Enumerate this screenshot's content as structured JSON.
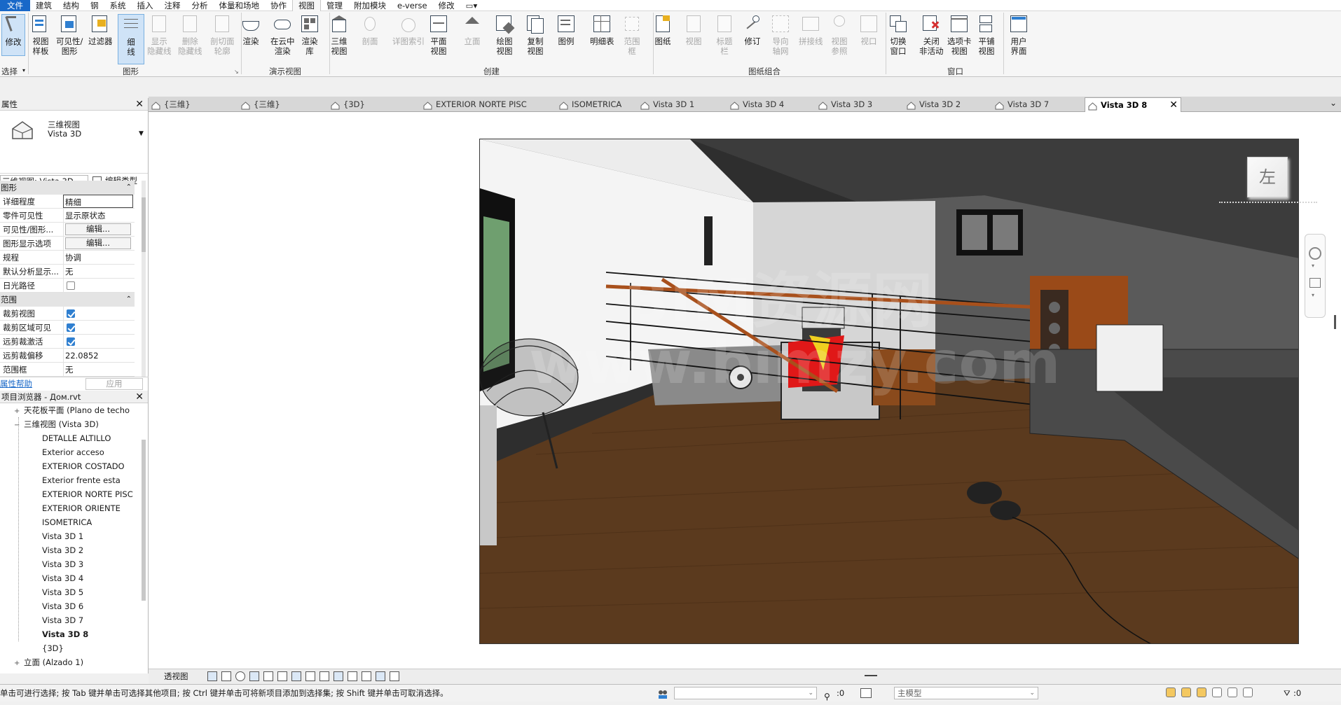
{
  "menu": {
    "items": [
      "文件",
      "建筑",
      "结构",
      "钢",
      "系统",
      "插入",
      "注释",
      "分析",
      "体量和场地",
      "协作",
      "视图",
      "管理",
      "附加模块",
      "e-verse",
      "修改"
    ],
    "active": "视图"
  },
  "ribbon": {
    "buttons": [
      {
        "label": "修改",
        "group": "select"
      },
      {
        "label": "视图\n样板",
        "group": "graphics"
      },
      {
        "label": "可见性/\n图形",
        "group": "graphics"
      },
      {
        "label": "过滤器",
        "group": "graphics"
      },
      {
        "label": "细\n线",
        "group": "graphics"
      },
      {
        "label": "显示\n隐藏线",
        "group": "graphics",
        "disabled": true
      },
      {
        "label": "删除\n隐藏线",
        "group": "graphics",
        "disabled": true
      },
      {
        "label": "剖切面\n轮廓",
        "group": "graphics",
        "disabled": true
      },
      {
        "label": "渲染",
        "group": "presentation"
      },
      {
        "label": "在云中\n渲染",
        "group": "presentation"
      },
      {
        "label": "渲染\n库",
        "group": "presentation"
      },
      {
        "label": "三维\n视图",
        "group": "create"
      },
      {
        "label": "剖面",
        "group": "create",
        "disabled": true
      },
      {
        "label": "详图索引",
        "group": "create",
        "disabled": true
      },
      {
        "label": "平面\n视图",
        "group": "create"
      },
      {
        "label": "立面",
        "group": "create",
        "disabled": true
      },
      {
        "label": "绘图\n视图",
        "group": "create"
      },
      {
        "label": "复制\n视图",
        "group": "create"
      },
      {
        "label": "图例",
        "group": "create"
      },
      {
        "label": "明细表",
        "group": "create"
      },
      {
        "label": "范围\n框",
        "group": "create",
        "disabled": true
      },
      {
        "label": "图纸",
        "group": "sheet"
      },
      {
        "label": "视图",
        "group": "sheet",
        "disabled": true
      },
      {
        "label": "标题\n栏",
        "group": "sheet",
        "disabled": true
      },
      {
        "label": "修订",
        "group": "sheet"
      },
      {
        "label": "导向\n轴网",
        "group": "sheet",
        "disabled": true
      },
      {
        "label": "拼接线",
        "group": "sheet",
        "disabled": true
      },
      {
        "label": "视图\n参照",
        "group": "sheet",
        "disabled": true
      },
      {
        "label": "视口",
        "group": "sheet",
        "disabled": true
      },
      {
        "label": "切换\n窗口",
        "group": "window"
      },
      {
        "label": "关闭\n非活动",
        "group": "window"
      },
      {
        "label": "选项卡\n视图",
        "group": "window"
      },
      {
        "label": "平铺\n视图",
        "group": "window"
      },
      {
        "label": "用户\n界面",
        "group": "window"
      }
    ],
    "panels": {
      "select": "选择",
      "graphics": "图形",
      "presentation": "演示视图",
      "create": "创建",
      "sheet": "图纸组合",
      "window": "窗口"
    }
  },
  "properties": {
    "title": "属性",
    "type_line1": "三维视图",
    "type_line2": "Vista 3D",
    "view_selector": "三维视图: Vista 3D",
    "edit_type": "编辑类型",
    "section_graphics": "图形",
    "rows_graphics": [
      {
        "k": "详细程度",
        "v": "精细"
      },
      {
        "k": "零件可见性",
        "v": "显示原状态"
      },
      {
        "k": "可见性/图形...",
        "v": "编辑..."
      },
      {
        "k": "图形显示选项",
        "v": "编辑..."
      },
      {
        "k": "规程",
        "v": "协调"
      },
      {
        "k": "默认分析显示...",
        "v": "无"
      },
      {
        "k": "日光路径",
        "v": ""
      }
    ],
    "section_extents": "范围",
    "rows_extents": [
      {
        "k": "裁剪视图",
        "checked": true
      },
      {
        "k": "裁剪区域可见",
        "checked": true
      },
      {
        "k": "远剪裁激活",
        "checked": true
      },
      {
        "k": "远剪裁偏移",
        "v": "22.0852"
      },
      {
        "k": "范围框",
        "v": "无"
      }
    ],
    "help_link": "属性帮助",
    "apply": "应用"
  },
  "browser": {
    "title": "项目浏览器 - Дом.rvt",
    "ceiling_node": "天花板平面 (Plano de techo",
    "views3d_node": "三维视图 (Vista 3D)",
    "items": [
      "DETALLE ALTILLO",
      "Exterior acceso",
      "EXTERIOR COSTADO",
      "Exterior frente esta",
      "EXTERIOR NORTE PISC",
      "EXTERIOR ORIENTE",
      "ISOMETRICA",
      "Vista 3D 1",
      "Vista 3D 2",
      "Vista 3D 3",
      "Vista 3D 4",
      "Vista 3D 5",
      "Vista 3D 6",
      "Vista 3D 7",
      "Vista 3D 8",
      "{3D}"
    ],
    "active_item": "Vista 3D 8",
    "elevation_node": "立面 (Alzado 1)"
  },
  "tabs": [
    "{三维}",
    "{三维}",
    "{3D}",
    "EXTERIOR NORTE PISC",
    "ISOMETRICA",
    "Vista 3D 1",
    "Vista 3D 4",
    "Vista 3D 3",
    "Vista 3D 2",
    "Vista 3D 7",
    "Vista 3D 8"
  ],
  "active_tab": "Vista 3D 8",
  "viewcube_face": "左",
  "watermark": {
    "line1": "BIM资源网",
    "line2": "www.bimzy.com"
  },
  "view_control": {
    "view_type": "透视图"
  },
  "status": {
    "message": "单击可进行选择; 按 Tab 键并单击可选择其他项目; 按 Ctrl 键并单击可将新项目添加到选择集; 按 Shift 键并单击可取消选择。",
    "counter1": ":0",
    "model": "主模型",
    "filter_count": ":0"
  },
  "colors": {
    "accent": "#1868c8",
    "selection_blue": "#2f7fd0",
    "floor": "#5b3a1e",
    "wall_dark": "#585858"
  }
}
